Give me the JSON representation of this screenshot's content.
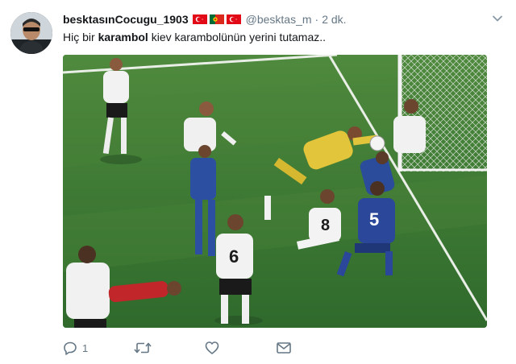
{
  "tweet": {
    "author": {
      "display_name": "besktasınCocugu_1903",
      "handle": "@besktas_m",
      "flags": [
        "turkey-flag",
        "portugal-flag",
        "turkey-flag"
      ]
    },
    "separator": "·",
    "timestamp": "2 dk.",
    "text": {
      "before": "Hiç bir ",
      "bold": "karambol",
      "after": " kiev karambolünün yerini tutamaz.."
    },
    "media": {
      "kind": "photo",
      "shirt_numbers": [
        "8",
        "5",
        "6"
      ]
    },
    "actions": {
      "reply": {
        "icon": "reply-icon",
        "count": "1"
      },
      "retweet": {
        "icon": "retweet-icon"
      },
      "like": {
        "icon": "heart-icon"
      },
      "message": {
        "icon": "envelope-icon"
      }
    }
  },
  "colors": {
    "name": "#14171a",
    "meta": "#657786",
    "pitch": "#3d7a35",
    "turkey_red": "#e30a17",
    "portugal_green": "#046a38",
    "portugal_red": "#da291c"
  }
}
